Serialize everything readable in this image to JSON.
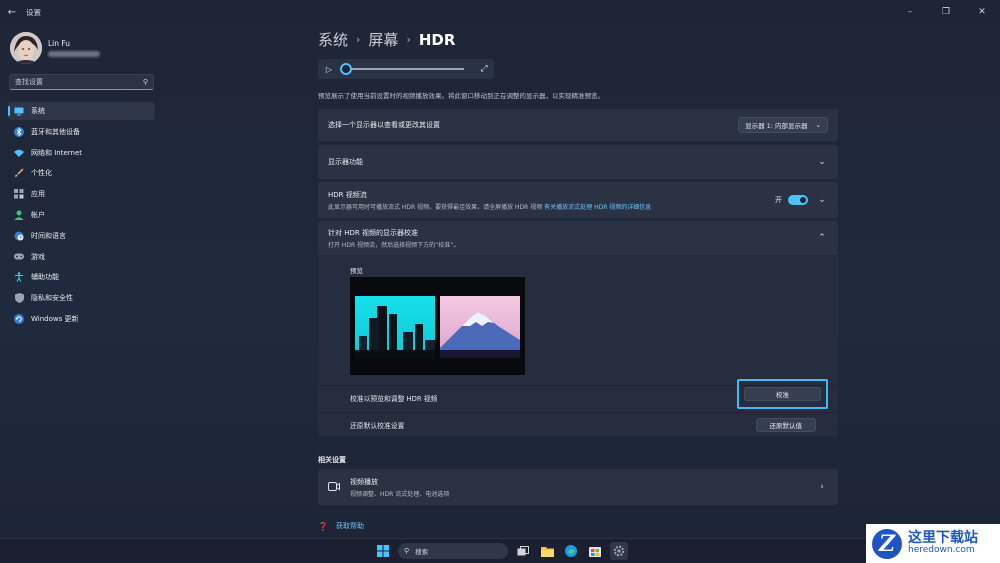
{
  "window": {
    "title": "设置",
    "back_icon": "arrow-left-icon"
  },
  "user": {
    "name": "Lin Fu"
  },
  "search": {
    "placeholder": "查找设置"
  },
  "nav": {
    "items": [
      {
        "label": "系统",
        "icon": "monitor-icon",
        "active": true,
        "color": "#4cc2ff"
      },
      {
        "label": "蓝牙和其他设备",
        "icon": "bluetooth-icon",
        "color": "#4cc2ff"
      },
      {
        "label": "网络和 Internet",
        "icon": "wifi-icon",
        "color": "#4cc2ff"
      },
      {
        "label": "个性化",
        "icon": "brush-icon",
        "color": "#e8a15a"
      },
      {
        "label": "应用",
        "icon": "apps-icon",
        "color": "#9aa4b5"
      },
      {
        "label": "帐户",
        "icon": "person-icon",
        "color": "#44c47a"
      },
      {
        "label": "时间和语言",
        "icon": "globe-clock-icon",
        "color": "#4cc2ff"
      },
      {
        "label": "游戏",
        "icon": "gamepad-icon",
        "color": "#9aa4b5"
      },
      {
        "label": "辅助功能",
        "icon": "accessibility-icon",
        "color": "#4cc2ff"
      },
      {
        "label": "隐私和安全性",
        "icon": "shield-icon",
        "color": "#9aa4b5"
      },
      {
        "label": "Windows 更新",
        "icon": "update-icon",
        "color": "#4cc2ff"
      }
    ]
  },
  "breadcrumb": {
    "part1": "系统",
    "part2": "屏幕",
    "current": "HDR"
  },
  "player": {
    "progress": 0
  },
  "description": "预览展示了使用当前设置时的视频播放效果。将此窗口移动到正在调整的显示器，以实现精准预览。",
  "display_select": {
    "label": "选择一个显示器以查看或更改其设置",
    "value": "显示器 1: 内部显示器"
  },
  "display_features": {
    "label": "显示器功能"
  },
  "hdr_streaming": {
    "title": "HDR 视频流",
    "subtitle": "此显示器可用时可播放流式 HDR 视频。要获得最佳效果，请全屏播放 HDR 视频",
    "link": "有关播放流式处理 HDR 视频的详细信息",
    "toggle_label": "开",
    "enabled": true
  },
  "calibration": {
    "title": "针对 HDR 视频的显示器校准",
    "subtitle": "打开 HDR 视频流，然后选择视频下方的“校准”。",
    "preview_label": "预览",
    "calibrate_row": "校准以预览和调整 HDR 视频",
    "calibrate_button": "校准",
    "reset_row": "还原默认校准设置",
    "reset_button": "还原默认值"
  },
  "related": {
    "heading": "相关设置",
    "video_playback": {
      "title": "视频播放",
      "subtitle": "视频调整、HDR 流式处理、电池选项"
    }
  },
  "help": {
    "label": "获取帮助"
  },
  "taskbar": {
    "search_label": "搜索"
  },
  "watermark": {
    "cn": "这里下载站",
    "en": "heredown.com"
  }
}
